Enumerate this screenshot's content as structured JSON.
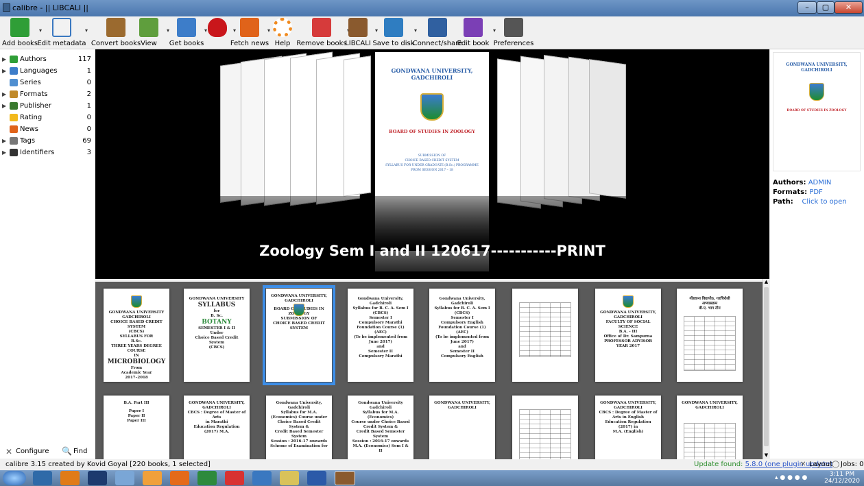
{
  "window": {
    "title": "calibre - || LIBCALI ||",
    "min": "–",
    "max": "▢",
    "close": "✕"
  },
  "toolbar": [
    {
      "label": "Add books",
      "icon": "add-books-icon",
      "color": "#2f9e37"
    },
    {
      "label": "Edit metadata",
      "icon": "edit-metadata-icon",
      "color": "#f2f2f2"
    },
    {
      "label": "Convert books",
      "icon": "convert-books-icon",
      "color": "#9b6a2f"
    },
    {
      "label": "View",
      "icon": "view-icon",
      "color": "#5f9e3d"
    },
    {
      "label": "Get books",
      "icon": "get-books-icon",
      "color": "#3d7dc9"
    },
    {
      "label": "",
      "icon": "heart-icon",
      "color": "#c9161b"
    },
    {
      "label": "Fetch news",
      "icon": "fetch-news-icon",
      "color": "#e0631a"
    },
    {
      "label": "Help",
      "icon": "help-icon",
      "color": "#f08a1f"
    },
    {
      "label": "Remove books",
      "icon": "remove-books-icon",
      "color": "#d63b3b"
    },
    {
      "label": "LIBCALI",
      "icon": "library-icon",
      "color": "#8a5a2e"
    },
    {
      "label": "Save to disk",
      "icon": "save-to-disk-icon",
      "color": "#2f7dc1"
    },
    {
      "label": "Connect/share",
      "icon": "connect-share-icon",
      "color": "#3060a0"
    },
    {
      "label": "Edit book",
      "icon": "edit-book-icon",
      "color": "#7b3fb5"
    },
    {
      "label": "Preferences",
      "icon": "preferences-icon",
      "color": "#555555"
    }
  ],
  "sidebar": {
    "items": [
      {
        "label": "Authors",
        "count": "117",
        "icon": "authors-icon",
        "color": "#2f9e37",
        "expandable": true
      },
      {
        "label": "Languages",
        "count": "1",
        "icon": "languages-icon",
        "color": "#3d7dc9",
        "expandable": true
      },
      {
        "label": "Series",
        "count": "0",
        "icon": "series-icon",
        "color": "#4f8fd1",
        "expandable": false
      },
      {
        "label": "Formats",
        "count": "2",
        "icon": "formats-icon",
        "color": "#c08a2a",
        "expandable": true
      },
      {
        "label": "Publisher",
        "count": "1",
        "icon": "publisher-icon",
        "color": "#3a7a2e",
        "expandable": true
      },
      {
        "label": "Rating",
        "count": "0",
        "icon": "rating-icon",
        "color": "#f2b91c",
        "expandable": false
      },
      {
        "label": "News",
        "count": "0",
        "icon": "news-icon",
        "color": "#e0631a",
        "expandable": false
      },
      {
        "label": "Tags",
        "count": "69",
        "icon": "tags-icon",
        "color": "#777777",
        "expandable": true
      },
      {
        "label": "Identifiers",
        "count": "3",
        "icon": "identifiers-icon",
        "color": "#333333",
        "expandable": true
      }
    ],
    "configure": "Configure",
    "find": "Find"
  },
  "cover_flow": {
    "title": "Zoology Sem I and II 120617-----------PRINT",
    "center": {
      "university": "GONDWANA UNIVERSITY, GADCHIROLI",
      "board": "BOARD OF STUDIES IN ZOOLOGY",
      "line1": "SUBMISSION OF",
      "line2": "CHOICE BASED CREDIT SYSTEM",
      "line3": "SYLLABUS FOR UNDER GRADUATE (B.Sc.) PROGRAMME",
      "line4": "FROM SESSION 2017 – 18"
    }
  },
  "grid": {
    "row1": [
      [
        "GONDWANA UNIVERSITY",
        "GADCHIROLI",
        "CHOICE BASED CREDIT SYSTEM",
        "(CBCS)",
        "SYLLABUS FOR",
        "B.Sc.",
        "THREE YEARS DEGREE COURSE",
        "IN",
        "MICROBIOLOGY",
        "From",
        "Academic Year",
        "2017–2018"
      ],
      [
        "GONDWANA UNIVERSITY",
        "SYLLABUS",
        "for",
        "B. Sc.",
        "BOTANY",
        "SEMESTER I & II",
        "Under",
        "Choice Based Credit System",
        "(CBCS)"
      ],
      [
        "GONDWANA UNIVERSITY,",
        "GADCHIROLI",
        "",
        "BOARD OF STUDIES IN ZOOLOGY",
        "SUBMISSION OF",
        "CHOICE BASED CREDIT SYSTEM"
      ],
      [
        "Gondwana University, Gadchiroli",
        "Syllabus for B. C. A. Sem I",
        "(CBCS)",
        "Semester I",
        "Compulsory Marathi",
        "Foundation Course (1) (AEC)",
        "(To be implemented from June 2017)",
        "and",
        "Semester II",
        "Compulsory Marathi"
      ],
      [
        "Gondwana University, Gadchiroli",
        "Syllabus for B. C. A. Sem I",
        "(CBCS)",
        "Semester I",
        "Compulsory English",
        "Foundation Course (1) (AEC)",
        "(To be implemented from June 2017)",
        "and",
        "Semester II",
        "Compulsory English"
      ],
      [
        "",
        "",
        "",
        ""
      ],
      [
        "GONDWANA UNIVERSITY,",
        "GADCHIROLI",
        "FACULTY OF SOCIAL SCIENCE",
        "B.A. - III",
        "Office of Dr. Sampurna",
        "PROFESSOR ADVISOR",
        "YEAR 2017"
      ],
      [
        "गोंडवाना विद्यापीठ, गडचिरोली",
        "अभ्यासक्रम",
        "बी.ए. भाग तीन",
        "",
        ""
      ]
    ],
    "row2": [
      [
        "B.A. Part III",
        "",
        "Paper I",
        "Paper II",
        "Paper III"
      ],
      [
        "GONDWANA UNIVERSITY,",
        "GADCHIROLI",
        "CBCS : Degree of Master of Arts",
        "in Marathi",
        "Education Regulation (2017) M.A."
      ],
      [
        "Gondwana University, Gadchiroli",
        "Syllabus for M.A. (Economics) Course under",
        "Choice Based Credit System &",
        "Credit Based Semester System",
        "Session : 2016-17 onwards",
        "Scheme of Examination for"
      ],
      [
        "Gondwana University Gadchiroli",
        "Syllabus for M.A. (Economics)",
        "Course under Choice Based Credit System &",
        "Credit Based Semester System",
        "Session : 2016-17 onwards",
        "M.A. (Economics) Sem I & II"
      ],
      [
        "GONDWANA UNIVERSITY, GADCHIROLI",
        "",
        "",
        ""
      ],
      [
        "",
        "",
        ""
      ],
      [
        "GONDWANA UNIVERSITY,",
        "GADCHIROLI",
        "CBCS : Degree of Master of",
        "Arts in English",
        "Education Regulation (2017) in",
        "M.A. (English)"
      ],
      [
        "GONDWANA UNIVERSITY, GADCHIROLI",
        "",
        "",
        ""
      ]
    ]
  },
  "details": {
    "cover_university": "GONDWANA UNIVERSITY, GADCHIROLI",
    "cover_board": "BOARD OF STUDIES IN ZOOLOGY",
    "authors_label": "Authors:",
    "authors_value": "ADMIN",
    "formats_label": "Formats:",
    "formats_value": "PDF",
    "path_label": "Path:",
    "path_value": "Click to open"
  },
  "status": {
    "left": "calibre 3.15 created by Kovid Goyal   [220 books, 1 selected]",
    "update_prefix": "Update found: ",
    "update_link": "5.8.0 (one plugin update)",
    "layout": "Layout",
    "jobs": "Jobs: 0"
  },
  "taskbar": {
    "time": "3:11 PM",
    "date": "24/12/2020"
  }
}
